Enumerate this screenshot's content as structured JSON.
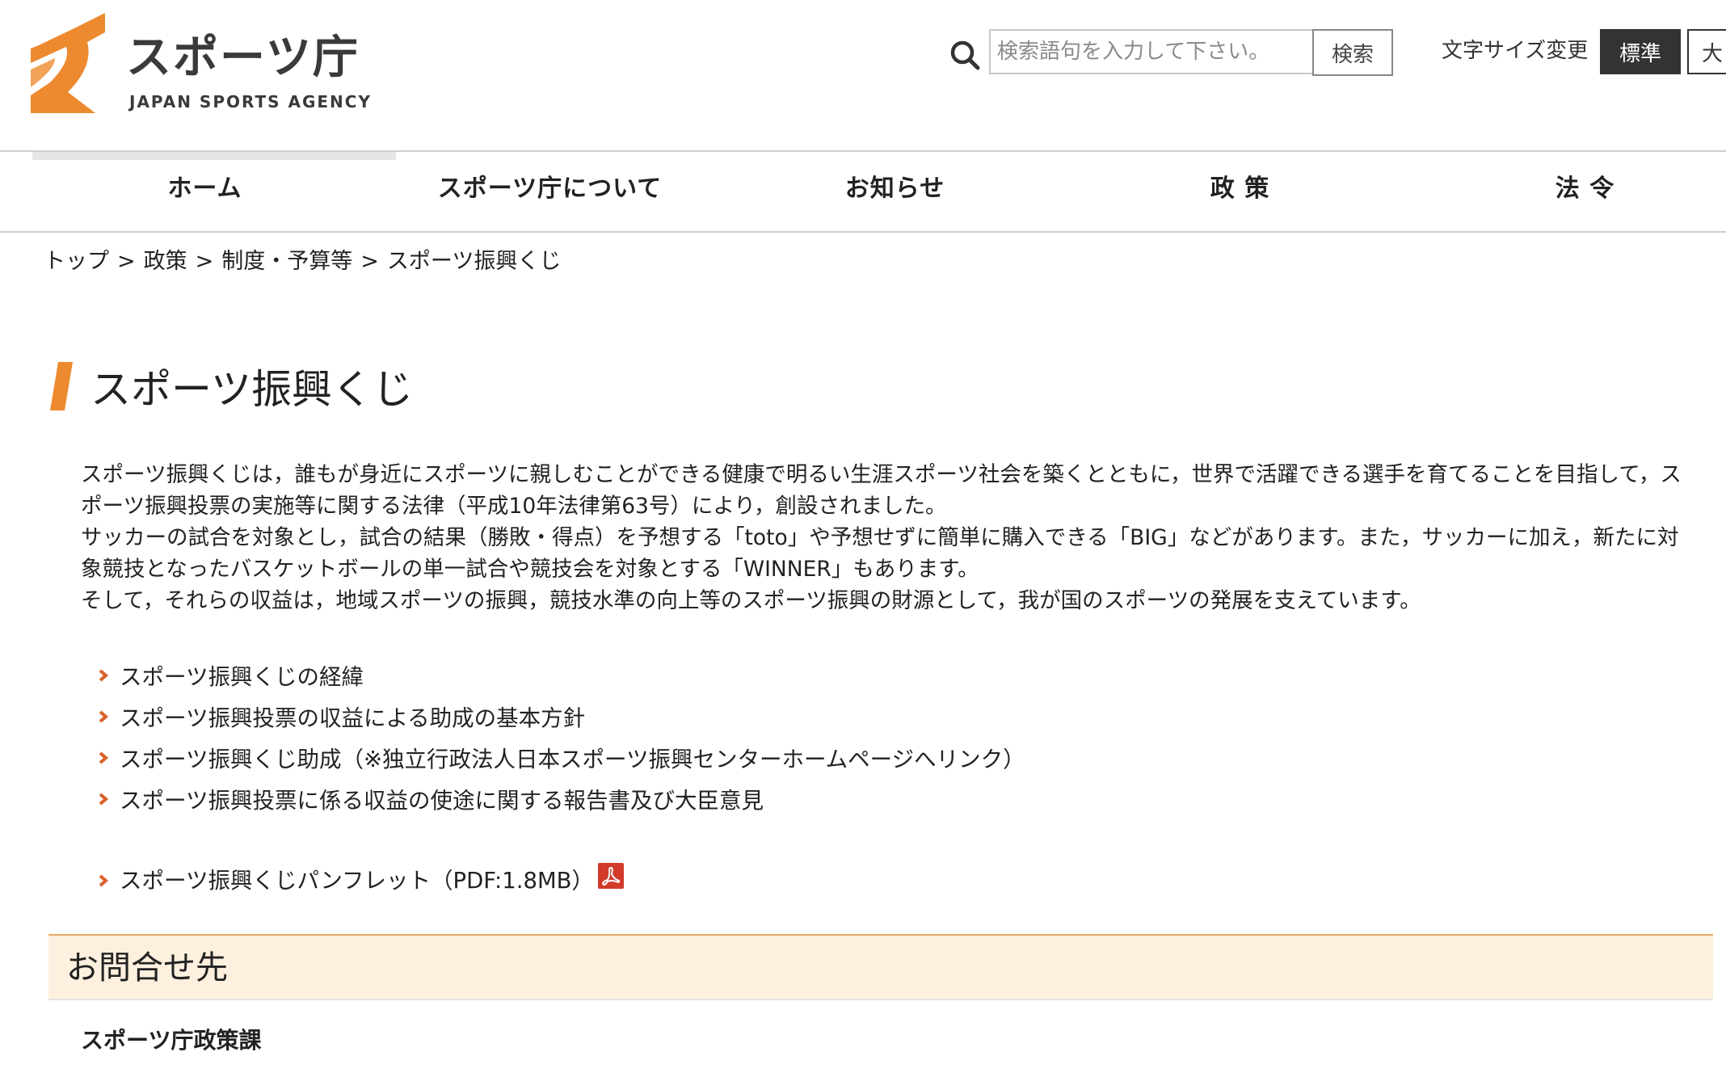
{
  "header": {
    "logo_name": "スポーツ庁",
    "logo_english": "JAPAN SPORTS AGENCY",
    "search_placeholder": "検索語句を入力して下さい。",
    "search_button": "検索",
    "fontsize_label": "文字サイズ変更",
    "fontsize_standard": "標準",
    "fontsize_large": "大",
    "brand_color": "#ed8a2f"
  },
  "nav": {
    "items": [
      {
        "label": "ホーム"
      },
      {
        "label": "スポーツ庁について"
      },
      {
        "label": "お知らせ"
      },
      {
        "label": "政 策"
      },
      {
        "label": "法 令"
      }
    ]
  },
  "breadcrumb": {
    "items": [
      "トップ",
      "政策",
      "制度・予算等",
      "スポーツ振興くじ"
    ],
    "separator": ">"
  },
  "main": {
    "title": "スポーツ振興くじ",
    "paragraphs": [
      "スポーツ振興くじは，誰もが身近にスポーツに親しむことができる健康で明るい生涯スポーツ社会を築くとともに，世界で活躍できる選手を育てることを目指して，スポーツ振興投票の実施等に関する法律（平成10年法律第63号）により，創設されました。",
      "サッカーの試合を対象とし，試合の結果（勝敗・得点）を予想する「toto」や予想せずに簡単に購入できる「BIG」などがあります。また，サッカーに加え，新たに対象競技となったバスケットボールの単一試合や競技会を対象とする「WINNER」もあります。",
      "そして，それらの収益は，地域スポーツの振興，競技水準の向上等のスポーツ振興の財源として，我が国のスポーツの発展を支えています。"
    ],
    "links": [
      {
        "label": "スポーツ振興くじの経緯"
      },
      {
        "label": "スポーツ振興投票の収益による助成の基本方針"
      },
      {
        "label": "スポーツ振興くじ助成（※独立行政法人日本スポーツ振興センターホームページへリンク）"
      },
      {
        "label": "スポーツ振興投票に係る収益の使途に関する報告書及び大臣意見"
      }
    ],
    "pamphlet": {
      "label": "スポーツ振興くじパンフレット（PDF:1.8MB）",
      "icon": "pdf-icon"
    }
  },
  "contact": {
    "heading": "お問合せ先",
    "department": "スポーツ庁政策課"
  },
  "colors": {
    "accent": "#ed8a2f",
    "chevron": "#d9602b",
    "contact_bg": "#fdf0de",
    "contact_border": "#e8a967",
    "pdf_red": "#d23a2a"
  }
}
